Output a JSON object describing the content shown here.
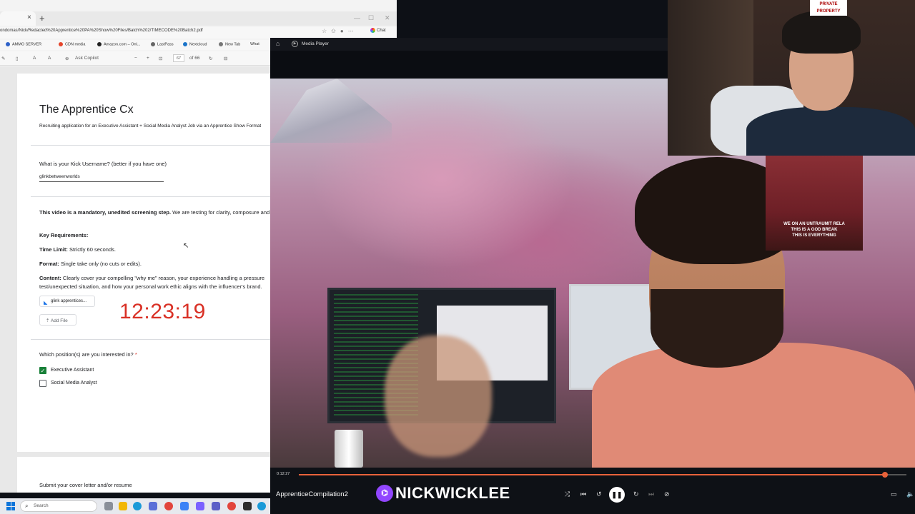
{
  "browser": {
    "tab_close": "×",
    "new_tab": "+",
    "address": "ondomas/Nick/Redacted%20Apprentice%20PA%20Show%20Files/Batch%202/TIMECODE%20Batch2.pdf",
    "chat_label": "Chat",
    "bookmarks": [
      "AMMO SERVER",
      "CDN media",
      "Amazon.com – Onl...",
      "LastPass",
      "Nextcloud",
      "New Tab",
      "What"
    ],
    "toolbar": {
      "ask_copilot": "Ask Copilot",
      "page_current": "67",
      "page_total": "of 66"
    }
  },
  "form": {
    "title": "The Apprentice Cx",
    "description": "Recruiting application for an Executive Assistant + Social Media Analyst Job via an Apprentice Show Format",
    "kick_question": "What is your Kick Username? (better if you have one)",
    "kick_answer": "glinkbetweenworlds",
    "video_intro_bold": "This video is a mandatory, unedited screening step.",
    "video_intro_rest": " We are testing for clarity, composure and confidence on camera.",
    "key_requirements": "Key Requirements:",
    "time_limit_label": "Time Limit:",
    "time_limit_value": " Strictly 60 seconds.",
    "format_label": "Format:",
    "format_value": " Single take only (no cuts or edits).",
    "content_label": "Content:",
    "content_value_1": " Clearly cover your compelling \"why me\" reason, your experience handling a pressure",
    "content_value_2": "test/unexpected situation, and how your personal work ethic aligns with the influencer's brand.",
    "file_chip": "glink apprentices...",
    "add_file": "Add File",
    "timer": "12:23:19",
    "position_question": "Which position(s) are you interested in?",
    "required_mark": "*",
    "options": [
      {
        "label": "Executive Assistant",
        "checked": true
      },
      {
        "label": "Social Media Analyst",
        "checked": false
      }
    ],
    "cover_letter": "Submit your cover letter and/or resume"
  },
  "taskbar": {
    "search_placeholder": "Search"
  },
  "player": {
    "title": "Media Player",
    "current_time": "0:12:27",
    "progress": 0.965,
    "file_name": "ApprenticeCompilation2",
    "brand_name": "NICKWICKLEE"
  },
  "webcam": {
    "sign_text_1": "PRIVATE",
    "sign_text_2": "PROPERTY"
  },
  "poster": {
    "line1": "WE ON AN UNTRAUMIT RELA",
    "line2": "THIS IS A GOD BREAK",
    "line3": "THIS IS EVERYTHING"
  },
  "colors": {
    "accent_red": "#d93025",
    "check_green": "#188038",
    "seek_orange": "#e8623a",
    "twitch_purple": "#9146ff"
  }
}
